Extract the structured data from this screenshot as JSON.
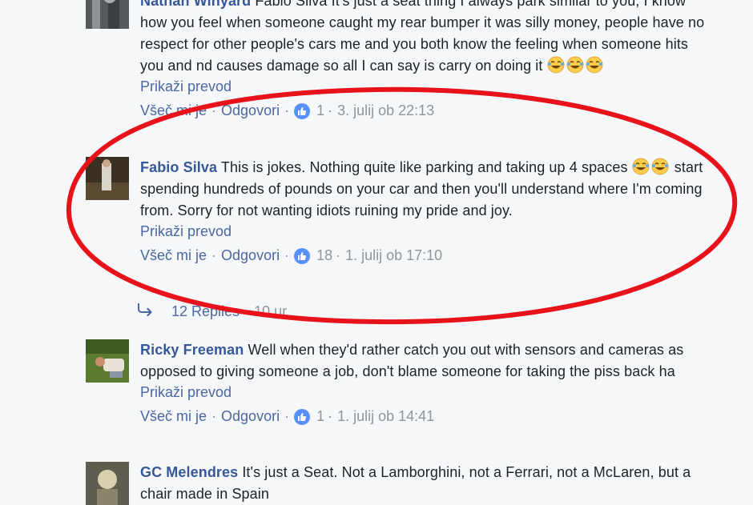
{
  "comments": [
    {
      "author": "Nathan Winyard",
      "text_before": " Fabio Silva It's just a seat thing I always park similar to you, I know how you feel when someone caught my rear bumper it was silly money, people have no respect for other people's cars me and you both know the feeling when someone hits you and nd causes damage so all I can say is carry on doing it ",
      "emojis": [
        "laughing-tears",
        "laughing-tears",
        "laughing-tears"
      ],
      "translate": "Prikaži prevod",
      "like": "Všeč mi je",
      "reply": "Odgovori",
      "likes": "1",
      "time": "3. julij ob 22:13"
    },
    {
      "author": "Fabio Silva",
      "text_before": " This is jokes. Nothing quite like parking and taking up 4 spaces ",
      "emojis": [
        "laughing-tears",
        "laughing-tears"
      ],
      "text_after": " start spending hundreds of pounds on your car and then you'll understand where I'm coming from. Sorry for not wanting idiots ruining my pride and joy.",
      "translate": "Prikaži prevod",
      "like": "Všeč mi je",
      "reply": "Odgovori",
      "likes": "18",
      "time": "1. julij ob 17:10",
      "replies_label": "12 Replies",
      "replies_time": "10 ur"
    },
    {
      "author": "Ricky Freeman",
      "text_before": " Well when they'd rather catch you out with sensors and cameras as opposed to giving someone a job, don't blame someone for taking the piss back ha",
      "translate": "Prikaži prevod",
      "like": "Všeč mi je",
      "reply": "Odgovori",
      "likes": "1",
      "time": "1. julij ob 14:41"
    },
    {
      "author": "GC Melendres",
      "text_before": " It's just a Seat. Not a Lamborghini, not a Ferrari, not a McLaren, but a chair made in Spain"
    }
  ],
  "separator": "·",
  "colors": {
    "link": "#365899",
    "muted": "#90949c",
    "like_blue": "#5890ff",
    "highlight_ellipse": "#e8121a",
    "background": "#f6f7f9"
  }
}
